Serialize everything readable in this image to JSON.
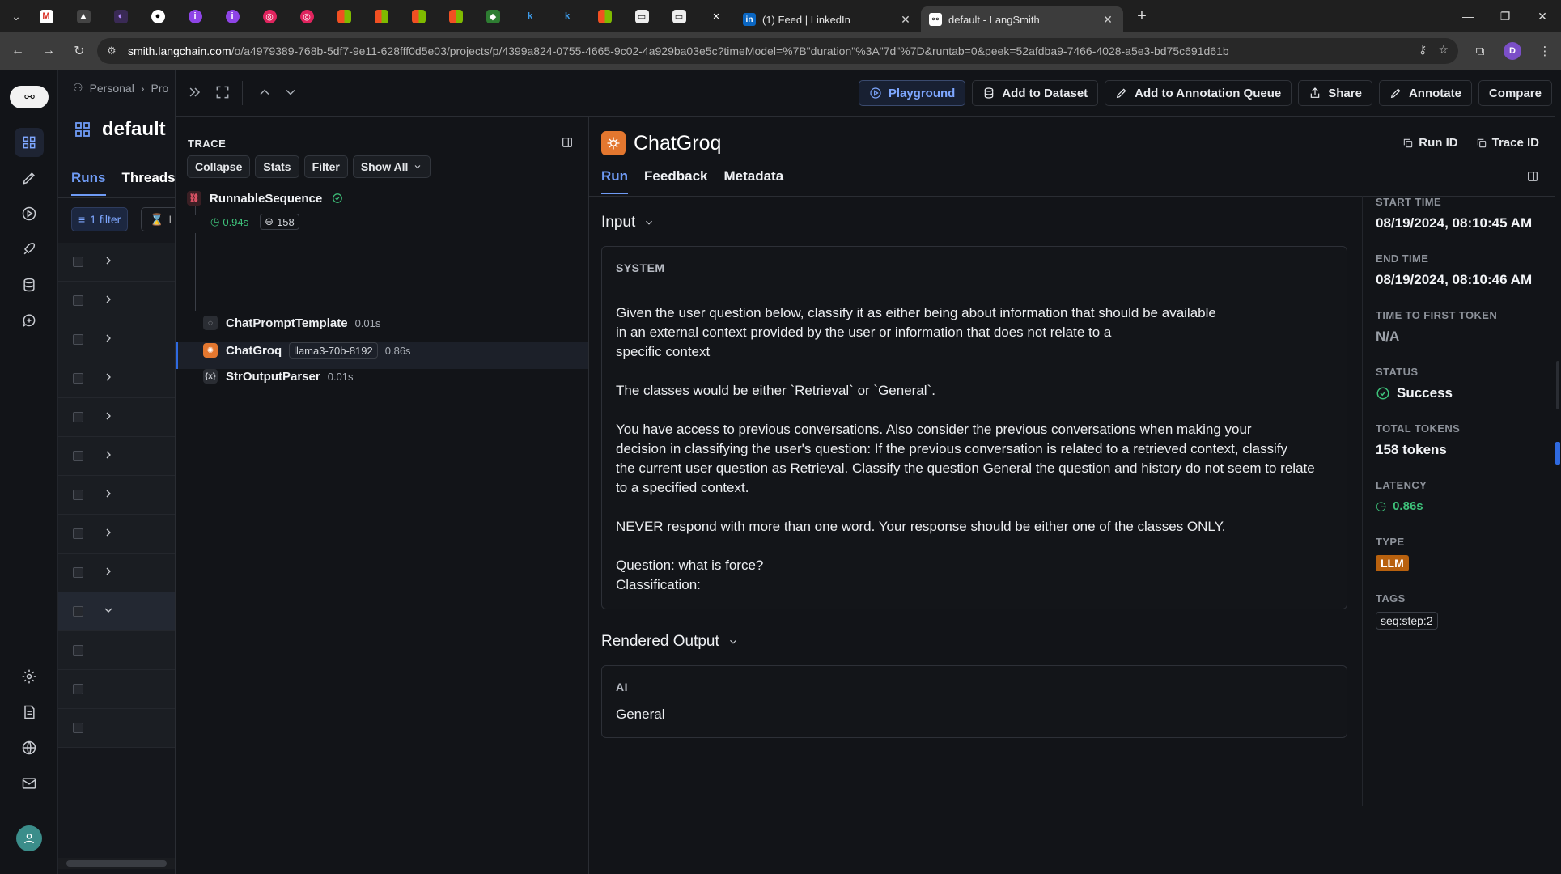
{
  "browser": {
    "tabs": [
      {
        "title": "(1) Feed | LinkedIn",
        "favicon": "linkedin-icon"
      },
      {
        "title": "default - LangSmith",
        "favicon": "langsmith-icon",
        "active": true
      }
    ],
    "url_host": "smith.langchain.com",
    "url_path": "/o/a4979389-768b-5df7-9e11-628fff0d5e03/projects/p/4399a824-0755-4665-9c02-4a929ba03e5c?timeModel=%7B\"duration\"%3A\"7d\"%7D&runtab=0&peek=52afdba9-7466-4028-a5e3-bd75c691d61b",
    "profile_initial": "D"
  },
  "runs_panel": {
    "breadcrumb": [
      "Personal",
      "Pro"
    ],
    "project_title": "default",
    "tabs": [
      "Runs",
      "Threads"
    ],
    "filter_label": "1 filter",
    "second_filter_label": "La"
  },
  "toolbar": {
    "playground": "Playground",
    "add_to_dataset": "Add to Dataset",
    "add_to_queue": "Add to Annotation Queue",
    "share": "Share",
    "annotate": "Annotate",
    "compare": "Compare"
  },
  "trace": {
    "title": "TRACE",
    "buttons": {
      "collapse": "Collapse",
      "stats": "Stats",
      "filter": "Filter",
      "show_all": "Show All"
    },
    "root": {
      "name": "RunnableSequence",
      "latency": "0.94s",
      "tokens": "158"
    },
    "children": [
      {
        "name": "ChatPromptTemplate",
        "time": "0.01s"
      },
      {
        "name": "ChatGroq",
        "model": "llama3-70b-8192",
        "time": "0.86s"
      },
      {
        "name": "StrOutputParser",
        "time": "0.01s"
      }
    ]
  },
  "detail": {
    "title": "ChatGroq",
    "run_id": "Run ID",
    "trace_id": "Trace ID",
    "tabs": [
      "Run",
      "Feedback",
      "Metadata"
    ],
    "input_title": "Input",
    "system_role": "SYSTEM",
    "system_message": "Given the user question below, classify it as either being about information that should be available\nin an external context provided by the user or information that does not relate to a\nspecific context\n\nThe classes would be either `Retrieval` or `General`.\n\nYou have access to previous conversations. Also consider the previous conversations when making your\ndecision in classifying the user's question: If the previous conversation is related to a retrieved context, classify\nthe current user question as Retrieval. Classify the question General the question and history do not seem to relate\nto a specified context.\n\nNEVER respond with more than one word. Your response should be either one of the classes ONLY.\n\nQuestion: what is force?\nClassification:",
    "output_title": "Rendered Output",
    "ai_role": "AI",
    "ai_message": "General"
  },
  "meta": {
    "start_time_label": "START TIME",
    "start_time": "08/19/2024, 08:10:45 AM",
    "end_time_label": "END TIME",
    "end_time": "08/19/2024, 08:10:46 AM",
    "ttft_label": "TIME TO FIRST TOKEN",
    "ttft": "N/A",
    "status_label": "STATUS",
    "status": "Success",
    "tokens_label": "TOTAL TOKENS",
    "tokens": "158 tokens",
    "latency_label": "LATENCY",
    "latency": "0.86s",
    "type_label": "TYPE",
    "type": "LLM",
    "tags_label": "TAGS",
    "tag": "seq:step:2"
  },
  "colors": {
    "accent": "#6f9bf5",
    "success": "#3ec27a",
    "llm_badge": "#b8610e",
    "groq": "#e3772f"
  }
}
